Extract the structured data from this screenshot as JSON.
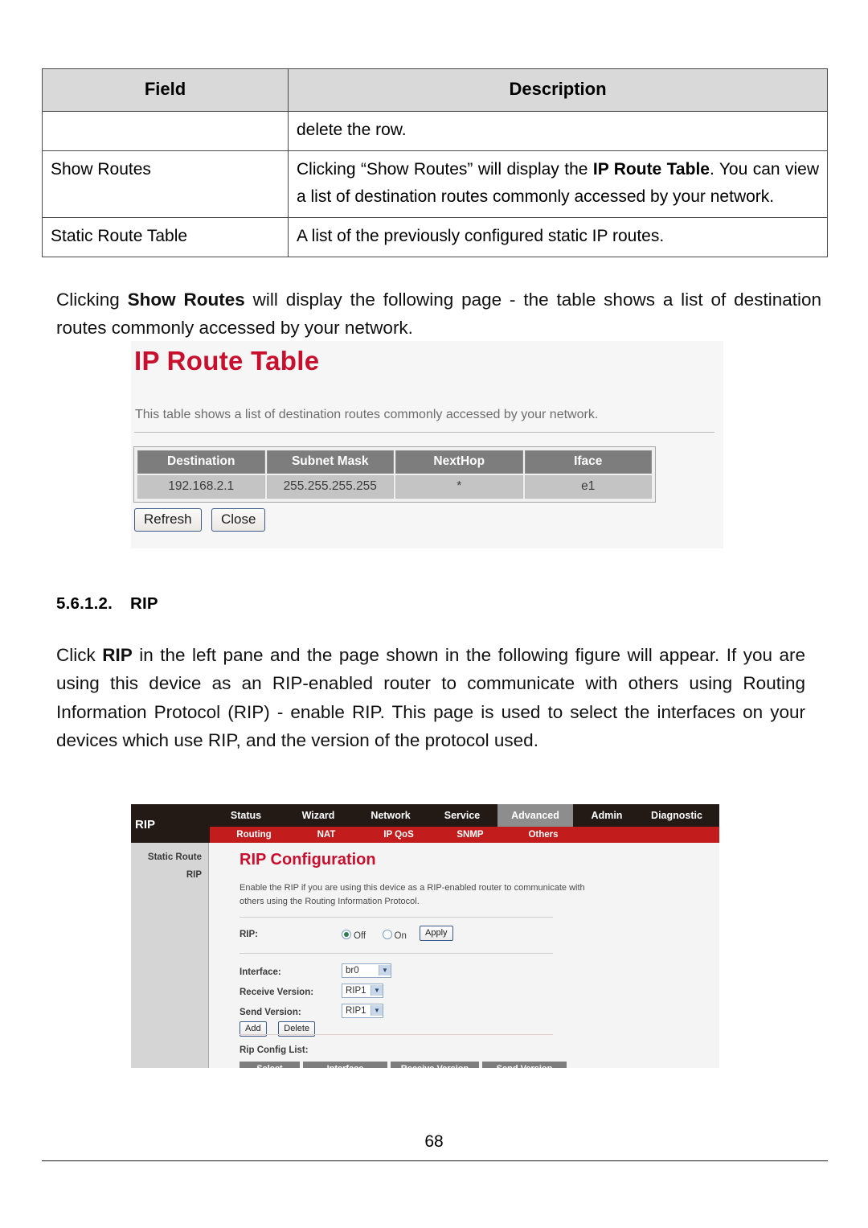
{
  "doc_table": {
    "headers": [
      "Field",
      "Description"
    ],
    "rows": [
      {
        "field": "",
        "description": "delete the row.",
        "justify": false
      },
      {
        "field": "Show Routes",
        "description_pre": "Clicking “Show Routes” will display the ",
        "description_bold": "IP Route Table",
        "description_post": ". You can view a list of destination routes commonly accessed by your network.",
        "justify": true
      },
      {
        "field": "Static Route Table",
        "description": "A list of the previously configured static IP routes.",
        "justify": false
      }
    ]
  },
  "paragraphs": {
    "show_routes_pre": "Clicking ",
    "show_routes_bold": "Show Routes",
    "show_routes_post": " will display the following page - the table shows a list of destination routes commonly accessed by your network.",
    "rip_pre": "Click ",
    "rip_bold": "RIP",
    "rip_post": " in the left pane and the page shown in the following figure will appear. If you are using this device as an RIP-enabled router to communicate with others using Routing Information Protocol (RIP) - enable RIP. This page is used to select the interfaces on your devices which use RIP, and the version of the protocol used."
  },
  "heading": {
    "number": "5.6.1.2.",
    "text": "RIP"
  },
  "ip_route_shot": {
    "title": "IP Route Table",
    "subtitle": "This table shows a list of destination routes commonly accessed by your network.",
    "table": {
      "headers": [
        "Destination",
        "Subnet Mask",
        "NextHop",
        "Iface"
      ],
      "rows": [
        [
          "192.168.2.1",
          "255.255.255.255",
          "*",
          "e1"
        ]
      ]
    },
    "buttons": [
      "Refresh",
      "Close"
    ],
    "title_color": "#c8102e",
    "header_bg": "#7d7d7d",
    "row_bg": "#c4c4c4"
  },
  "rip_shot": {
    "brand": "RIP",
    "nav_main": [
      {
        "label": "Status",
        "active": false
      },
      {
        "label": "Wizard",
        "active": false
      },
      {
        "label": "Network",
        "active": false
      },
      {
        "label": "Service",
        "active": false
      },
      {
        "label": "Advanced",
        "active": true
      },
      {
        "label": "Admin",
        "active": false
      },
      {
        "label": "Diagnostic",
        "active": false
      }
    ],
    "nav_sub": [
      "Routing",
      "NAT",
      "IP QoS",
      "SNMP",
      "Others"
    ],
    "left_pane": [
      "Static Route",
      "RIP"
    ],
    "content": {
      "title": "RIP Configuration",
      "description": "Enable the RIP if you are using this device as a RIP-enabled router to communicate with others using the Routing Information Protocol.",
      "rip_label": "RIP:",
      "radio_off": "Off",
      "radio_on": "On",
      "radio_selected": "Off",
      "apply_label": "Apply",
      "interface_label": "Interface:",
      "interface_value": "br0",
      "receive_version_label": "Receive Version:",
      "receive_version_value": "RIP1",
      "send_version_label": "Send Version:",
      "send_version_value": "RIP1",
      "add_label": "Add",
      "delete_label": "Delete",
      "config_list_label": "Rip Config List:",
      "config_list_headers": [
        "Select",
        "Interface",
        "Receive Version",
        "Send Version"
      ]
    },
    "nav_bar_bg": "#231a16",
    "nav_sub_bg": "#c31c1c",
    "active_tab_bg": "#8d8d8d",
    "title_color": "#c8102e"
  },
  "footer": {
    "page_number": "68"
  }
}
